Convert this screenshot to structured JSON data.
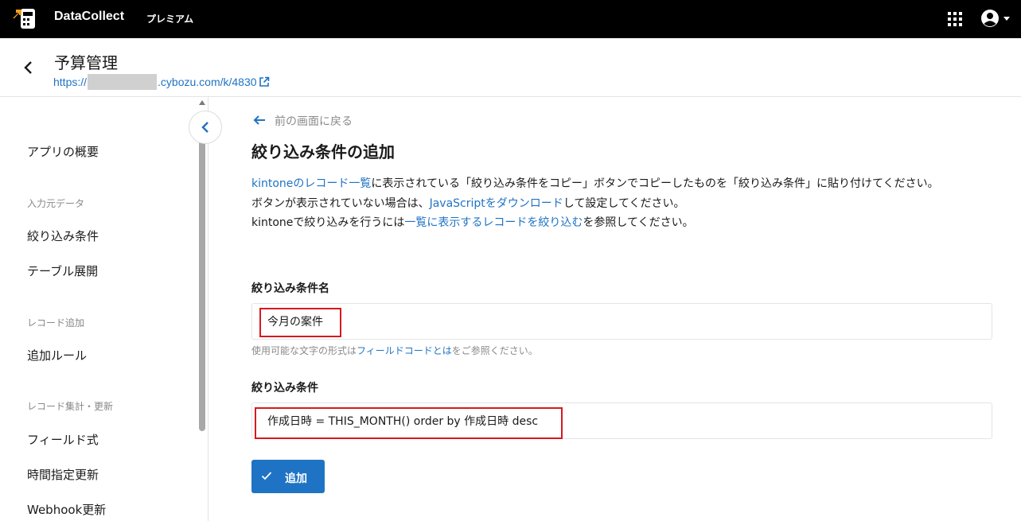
{
  "topbar": {
    "brand": "DataCollect",
    "plan": "プレミアム"
  },
  "header": {
    "app_title": "予算管理",
    "url_prefix": "https://",
    "url_suffix": ".cybozu.com/k/4830"
  },
  "sidebar": {
    "items": [
      {
        "label": "アプリの概要"
      },
      {
        "group": "入力元データ"
      },
      {
        "label": "絞り込み条件"
      },
      {
        "label": "テーブル展開"
      },
      {
        "group": "レコード追加"
      },
      {
        "label": "追加ルール"
      },
      {
        "group": "レコード集計・更新"
      },
      {
        "label": "フィールド式"
      },
      {
        "label": "時間指定更新"
      },
      {
        "label": "Webhook更新"
      }
    ]
  },
  "main": {
    "back_link": "前の画面に戻る",
    "title": "絞り込み条件の追加",
    "desc1_link": "kintoneのレコード一覧",
    "desc1_text": "に表示されている「絞り込み条件をコピー」ボタンでコピーしたものを「絞り込み条件」に貼り付けてください。",
    "desc2_text_a": "ボタンが表示されていない場合は、",
    "desc2_link": "JavaScriptをダウンロード",
    "desc2_text_b": "して設定してください。",
    "desc3_text_a": "kintoneで絞り込みを行うには",
    "desc3_link": "一覧に表示するレコードを絞り込む",
    "desc3_text_b": "を参照してください。",
    "name_label": "絞り込み条件名",
    "name_value": "今月の案件",
    "hint_text_a": "使用可能な文字の形式は",
    "hint_link": "フィールドコードとは",
    "hint_text_b": "をご参照ください。",
    "cond_label": "絞り込み条件",
    "cond_value": "作成日時 = THIS_MONTH() order by 作成日時 desc",
    "add_button": "追加"
  },
  "colors": {
    "topbar": "#000000",
    "link": "#1f73c4",
    "primary_button": "#1f73c4",
    "highlight": "#d7191f",
    "muted_text": "#8a8a8a"
  },
  "icons": [
    "datacollect-logo-icon",
    "apps-grid-icon",
    "account-circle-icon",
    "caret-down-icon",
    "chevron-left-icon",
    "external-link-icon",
    "arrow-left-icon",
    "check-icon"
  ]
}
